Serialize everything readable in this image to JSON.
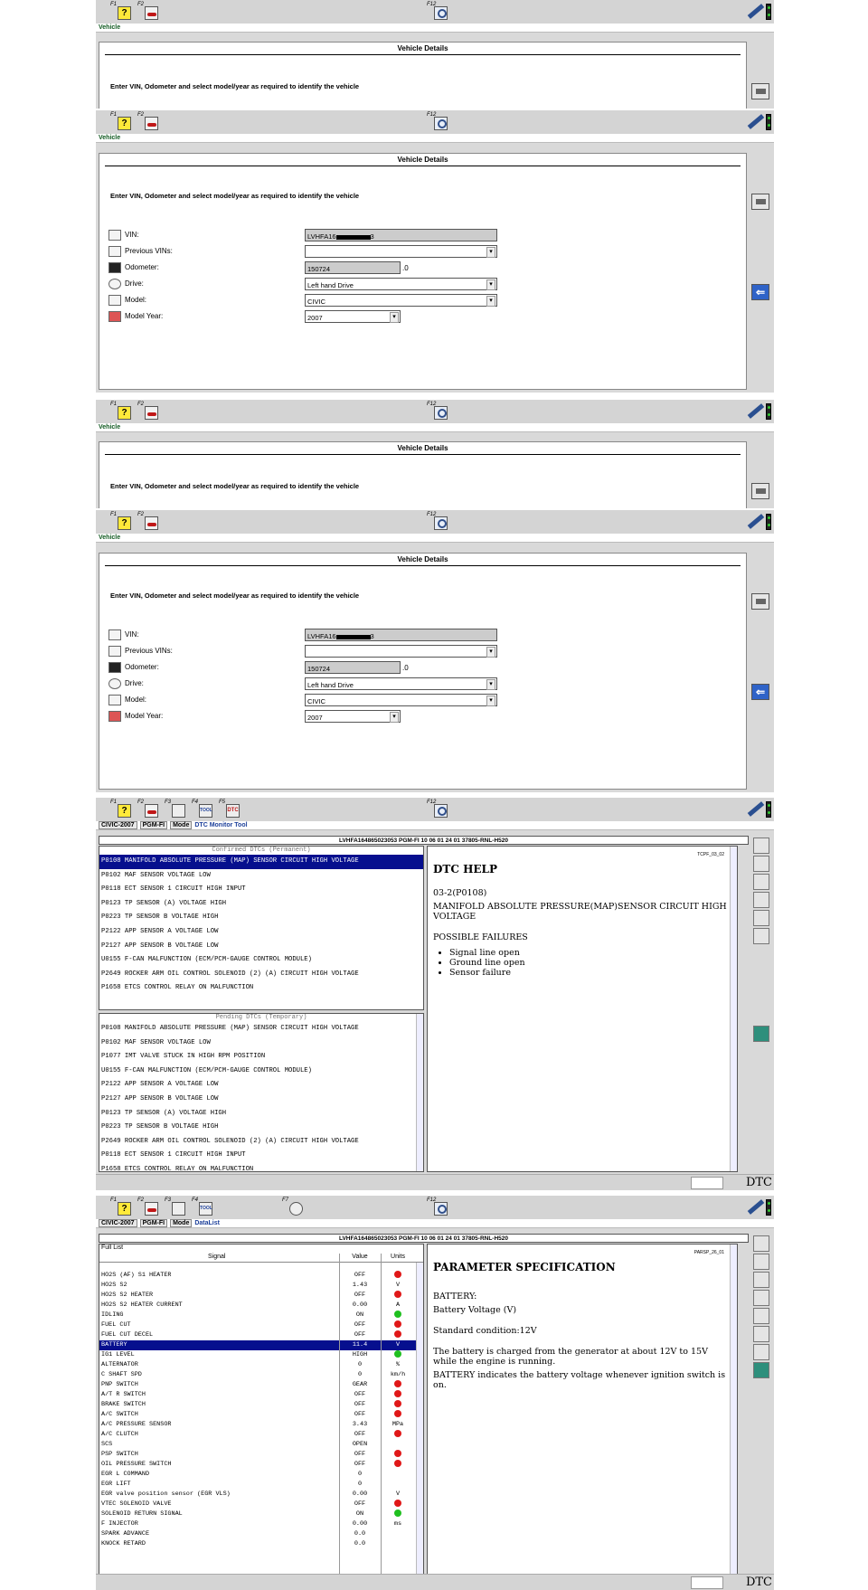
{
  "toolbar": {
    "f1": "F1",
    "f2": "F2",
    "f3": "F3",
    "f4": "F4",
    "f5": "F5",
    "f7": "F7",
    "f12": "F12",
    "help_glyph": "?",
    "tool_label": "TOOL",
    "dtc_label": "DTC"
  },
  "breadcrumb_vehicle": "Vehicle",
  "vehicle_details": {
    "title": "Vehicle Details",
    "instruction": "Enter VIN, Odometer and select model/year as required to identify the vehicle",
    "vin_label": "VIN:",
    "vin_prefix": "LVHFA16",
    "vin_suffix": "3",
    "prev_vins_label": "Previous VINs:",
    "prev_vins_value": "",
    "odometer_label": "Odometer:",
    "odometer_value": "150724",
    "odometer_unit": ".0",
    "drive_label": "Drive:",
    "drive_value": "Left hand Drive",
    "model_label": "Model:",
    "model_value": "CIVIC",
    "year_label": "Model Year:",
    "year_value": "2007",
    "back_glyph": "⇐"
  },
  "dtc_screen": {
    "crumbs": [
      "CIVIC-2007",
      "PGM-FI",
      "Mode",
      "DTC Monitor Tool"
    ],
    "vehicle_info": "LVHFA16486502​3053  PGM-FI  10 06 01 24 01  37805-RNL-H520",
    "confirmed_caption": "Confirmed DTCs (Permanent)",
    "confirmed": [
      "P0108 MANIFOLD ABSOLUTE PRESSURE (MAP)  SENSOR CIRCUIT HIGH VOLTAGE",
      "P0102 MAF SENSOR VOLTAGE LOW",
      "P0118 ECT SENSOR 1 CIRCUIT HIGH INPUT",
      "P0123 TP SENSOR (A) VOLTAGE HIGH",
      "P0223 TP SENSOR B VOLTAGE HIGH",
      "P2122 APP SENSOR A VOLTAGE LOW",
      "P2127 APP SENSOR B VOLTAGE LOW",
      "U0155 F-CAN MALFUNCTION (ECM/PCM-GAUGE CONTROL MODULE)",
      "P2649 ROCKER ARM OIL CONTROL SOLENOID  (2) (A) CIRCUIT HIGH VOLTAGE",
      "P1658 ETCS CONTROL RELAY ON MALFUNCTION"
    ],
    "pending_caption": "Pending DTCs (Temporary)",
    "pending": [
      "P0108 MANIFOLD ABSOLUTE PRESSURE (MAP)  SENSOR CIRCUIT HIGH VOLTAGE",
      "P0102 MAF SENSOR VOLTAGE LOW",
      "P1077 IMT VALVE STUCK IN HIGH RPM POSITION",
      "U0155 F-CAN MALFUNCTION (ECM/PCM-GAUGE CONTROL MODULE)",
      "P2122 APP SENSOR A VOLTAGE LOW",
      "P2127 APP SENSOR B VOLTAGE LOW",
      "P0123 TP SENSOR (A) VOLTAGE HIGH",
      "P0223 TP SENSOR B VOLTAGE HIGH",
      "P2649 ROCKER ARM OIL CONTROL SOLENOID  (2) (A) CIRCUIT HIGH VOLTAGE",
      "P0118 ECT SENSOR 1 CIRCUIT HIGH INPUT",
      "P1658 ETCS CONTROL RELAY ON MALFUNCTION"
    ],
    "help_code": "TCPF_03_02",
    "help_title": "DTC HELP",
    "help_ref": "03-2(P0108)",
    "help_desc": "MANIFOLD ABSOLUTE PRESSURE(MAP)SENSOR CIRCUIT HIGH VOLTAGE",
    "failures_title": "POSSIBLE FAILURES",
    "failures": [
      "Signal line open",
      "Ground line open",
      "Sensor failure"
    ],
    "status_dtc": "DTC"
  },
  "datalist_screen": {
    "crumbs": [
      "CIVIC-2007",
      "PGM-FI",
      "Mode",
      "DataList"
    ],
    "vehicle_info": "LVHFA16486502​3053  PGM-FI  10 06 01 24 01  37805-RNL-H520",
    "list_title": "Full List",
    "col_signal": "Signal",
    "col_value": "Value",
    "col_units": "Units",
    "rows": [
      {
        "s": "HO2S (AF) S1 HEATER",
        "v": "OFF",
        "u": "",
        "dot": "red"
      },
      {
        "s": "HO2S S2",
        "v": "1.43",
        "u": "V",
        "dot": ""
      },
      {
        "s": "HO2S S2 HEATER",
        "v": "OFF",
        "u": "",
        "dot": "red"
      },
      {
        "s": "HO2S S2 HEATER CURRENT",
        "v": "0.00",
        "u": "A",
        "dot": ""
      },
      {
        "s": "IDLING",
        "v": "ON",
        "u": "",
        "dot": "grn"
      },
      {
        "s": "FUEL CUT",
        "v": "OFF",
        "u": "",
        "dot": "red"
      },
      {
        "s": "FUEL CUT DECEL",
        "v": "OFF",
        "u": "",
        "dot": "red"
      },
      {
        "s": "BATTERY",
        "v": "11.4",
        "u": "V",
        "dot": "",
        "hi": true
      },
      {
        "s": "IG1 LEVEL",
        "v": "HIGH",
        "u": "",
        "dot": "grn"
      },
      {
        "s": "ALTERNATOR",
        "v": "0",
        "u": "%",
        "dot": ""
      },
      {
        "s": "C SHAFT SPD",
        "v": "0",
        "u": "km/h",
        "dot": ""
      },
      {
        "s": "PNP SWITCH",
        "v": "GEAR",
        "u": "",
        "dot": "red"
      },
      {
        "s": "A/T R SWITCH",
        "v": "OFF",
        "u": "",
        "dot": "red"
      },
      {
        "s": "BRAKE SWITCH",
        "v": "OFF",
        "u": "",
        "dot": "red"
      },
      {
        "s": "A/C SWITCH",
        "v": "OFF",
        "u": "",
        "dot": "red"
      },
      {
        "s": "A/C PRESSURE SENSOR",
        "v": "3.43",
        "u": "MPa",
        "dot": ""
      },
      {
        "s": "A/C CLUTCH",
        "v": "OFF",
        "u": "",
        "dot": "red"
      },
      {
        "s": "SCS",
        "v": "OPEN",
        "u": "",
        "dot": ""
      },
      {
        "s": "PSP SWITCH",
        "v": "OFF",
        "u": "",
        "dot": "red"
      },
      {
        "s": "OIL PRESSURE SWITCH",
        "v": "OFF",
        "u": "",
        "dot": "red"
      },
      {
        "s": "EGR L COMMAND",
        "v": "0",
        "u": "",
        "dot": ""
      },
      {
        "s": "EGR LIFT",
        "v": "0",
        "u": "",
        "dot": ""
      },
      {
        "s": "EGR valve position sensor (EGR VLS)",
        "v": "0.00",
        "u": "V",
        "dot": ""
      },
      {
        "s": "VTEC SOLENOID VALVE",
        "v": "OFF",
        "u": "",
        "dot": "red"
      },
      {
        "s": "SOLENOID RETURN SIGNAL",
        "v": "ON",
        "u": "",
        "dot": "grn"
      },
      {
        "s": "F INJECTOR",
        "v": "0.00",
        "u": "ms",
        "dot": ""
      },
      {
        "s": "SPARK ADVANCE",
        "v": "0.0",
        "u": "",
        "dot": ""
      },
      {
        "s": "KNOCK RETARD",
        "v": "0.0",
        "u": "",
        "dot": ""
      }
    ],
    "help_code": "PARSP_26_01",
    "spec_title": "PARAMETER SPECIFICATION",
    "spec_name": "BATTERY:",
    "spec_unit": "Battery Voltage (V)",
    "spec_std": "Standard condition:12V",
    "spec_desc1": "The battery is charged from the generator at about 12V to 15V while the engine is running.",
    "spec_desc2": "BATTERY indicates the battery voltage whenever ignition switch is on.",
    "status_dtc": "DTC"
  }
}
